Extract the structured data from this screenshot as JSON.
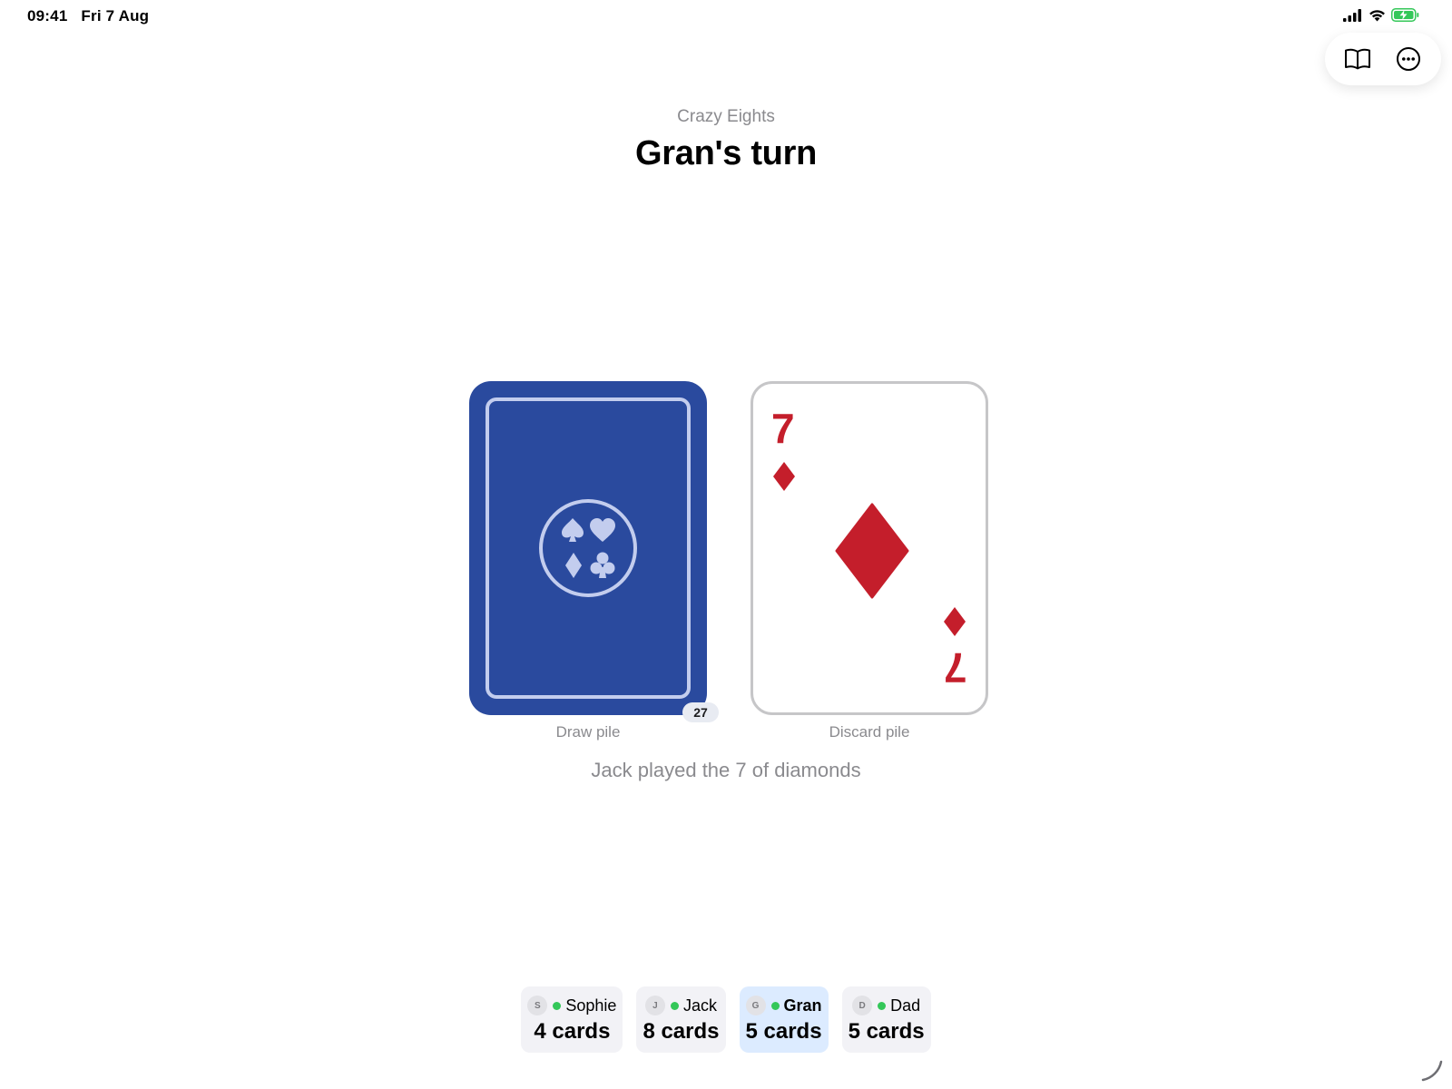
{
  "status_bar": {
    "time": "09:41",
    "date": "Fri 7 Aug",
    "icons": [
      "cellular-signal-icon",
      "wifi-icon",
      "battery-charging-icon"
    ]
  },
  "toolbar": {
    "buttons": [
      {
        "icon": "book-icon"
      },
      {
        "icon": "more-ellipsis-icon"
      }
    ]
  },
  "header": {
    "game_name": "Crazy Eights",
    "turn_title": "Gran's turn"
  },
  "table": {
    "draw_pile": {
      "label": "Draw pile",
      "count": "27",
      "back_color": "#2a4a9e",
      "emblem_icons": [
        "spade-icon",
        "heart-icon",
        "diamond-icon",
        "club-icon"
      ]
    },
    "discard_pile": {
      "label": "Discard pile",
      "top_card": {
        "rank": "7",
        "suit": "diamonds",
        "suit_icon": "diamond-icon",
        "color": "#c41e2b"
      }
    },
    "last_action": "Jack played the 7 of diamonds"
  },
  "players": [
    {
      "initial": "S",
      "name": "Sophie",
      "cards": "4 cards",
      "online": true,
      "active": false
    },
    {
      "initial": "J",
      "name": "Jack",
      "cards": "8 cards",
      "online": true,
      "active": false
    },
    {
      "initial": "G",
      "name": "Gran",
      "cards": "5 cards",
      "online": true,
      "active": true
    },
    {
      "initial": "D",
      "name": "Dad",
      "cards": "5 cards",
      "online": true,
      "active": false
    }
  ],
  "colors": {
    "accent_active_player": "#dcebff",
    "online": "#34c759",
    "card_red": "#c41e2b",
    "muted_text": "#8a8a8e"
  }
}
